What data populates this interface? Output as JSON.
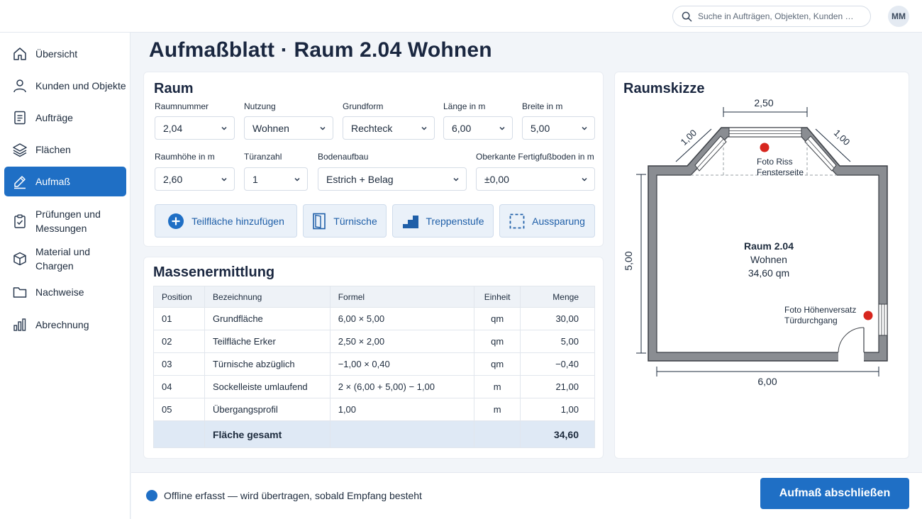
{
  "header": {
    "search_placeholder": "Suche in Aufträgen, Objekten, Kunden …",
    "avatar_initials": "MM"
  },
  "sidebar": {
    "items": [
      {
        "label": "Übersicht",
        "icon": "home-icon"
      },
      {
        "label": "Kunden und Objekte",
        "icon": "user-icon"
      },
      {
        "label": "Aufträge",
        "icon": "document-icon"
      },
      {
        "label": "Flächen",
        "icon": "layers-icon"
      },
      {
        "label": "Aufmaß",
        "icon": "ruler-pencil-icon",
        "active": true
      },
      {
        "label": "Prüfungen und Messungen",
        "icon": "clipboard-check-icon"
      },
      {
        "label": "Material und Chargen",
        "icon": "box-icon"
      },
      {
        "label": "Nachweise",
        "icon": "folder-icon"
      },
      {
        "label": "Abrechnung",
        "icon": "bar-chart-icon"
      }
    ]
  },
  "page": {
    "title": "Aufmaßblatt · Raum 2.04 Wohnen"
  },
  "raum": {
    "title": "Raum",
    "fields": {
      "raumnummer": {
        "label": "Raumnummer",
        "value": "2,04"
      },
      "nutzung": {
        "label": "Nutzung",
        "value": "Wohnen"
      },
      "grundform": {
        "label": "Grundform",
        "value": "Rechteck"
      },
      "laenge": {
        "label": "Länge in m",
        "value": "6,00"
      },
      "breite": {
        "label": "Breite in m",
        "value": "5,00"
      },
      "raumhoehe": {
        "label": "Raumhöhe in m",
        "value": "2,60"
      },
      "tueranzahl": {
        "label": "Türanzahl",
        "value": "1"
      },
      "bodenaufbau": {
        "label": "Bodenaufbau",
        "value": "Estrich + Belag"
      },
      "okff": {
        "label": "Oberkante Fertigfußboden in m",
        "value": "±0,00"
      }
    },
    "actions": {
      "teilflaeche": "Teilfläche hinzufügen",
      "tuernische": "Türnische",
      "treppenstufe": "Treppenstufe",
      "aussparung": "Aussparung"
    }
  },
  "massen": {
    "title": "Massenermittlung",
    "columns": {
      "position": "Position",
      "bezeichnung": "Bezeichnung",
      "formel": "Formel",
      "einheit": "Einheit",
      "menge": "Menge"
    },
    "rows": [
      {
        "position": "01",
        "bezeichnung": "Grundfläche",
        "formel": "6,00 × 5,00",
        "einheit": "qm",
        "menge": "30,00"
      },
      {
        "position": "02",
        "bezeichnung": "Teilfläche Erker",
        "formel": "2,50 × 2,00",
        "einheit": "qm",
        "menge": "5,00"
      },
      {
        "position": "03",
        "bezeichnung": "Türnische abzüglich",
        "formel": "−1,00 × 0,40",
        "einheit": "qm",
        "menge": "−0,40"
      },
      {
        "position": "04",
        "bezeichnung": "Sockelleiste umlaufend",
        "formel": "2 × (6,00 + 5,00) − 1,00",
        "einheit": "m",
        "menge": "21,00"
      },
      {
        "position": "05",
        "bezeichnung": "Übergangsprofil",
        "formel": "1,00",
        "einheit": "m",
        "menge": "1,00"
      }
    ],
    "total": {
      "label": "Fläche gesamt",
      "value": "34,60"
    }
  },
  "sketch": {
    "title": "Raumskizze",
    "dim_top": "2,50",
    "dim_diag_left": "1,00",
    "dim_diag_right": "1,00",
    "dim_left": "5,00",
    "dim_bottom": "6,00",
    "room_name": "Raum 2.04",
    "room_use": "Wohnen",
    "room_area": "34,60 qm",
    "photo1_line1": "Foto Riss",
    "photo1_line2": "Fensterseite",
    "photo2_line1": "Foto Höhenversatz",
    "photo2_line2": "Türdurchgang",
    "marker_color": "#d7261e",
    "wall_color": "#8a8d92"
  },
  "footer": {
    "status": "Offline erfasst — wird übertragen, sobald Empfang besteht",
    "submit": "Aufmaß abschließen"
  },
  "colors": {
    "accent": "#1f6fc5",
    "active_nav": "#1f6fc5"
  }
}
